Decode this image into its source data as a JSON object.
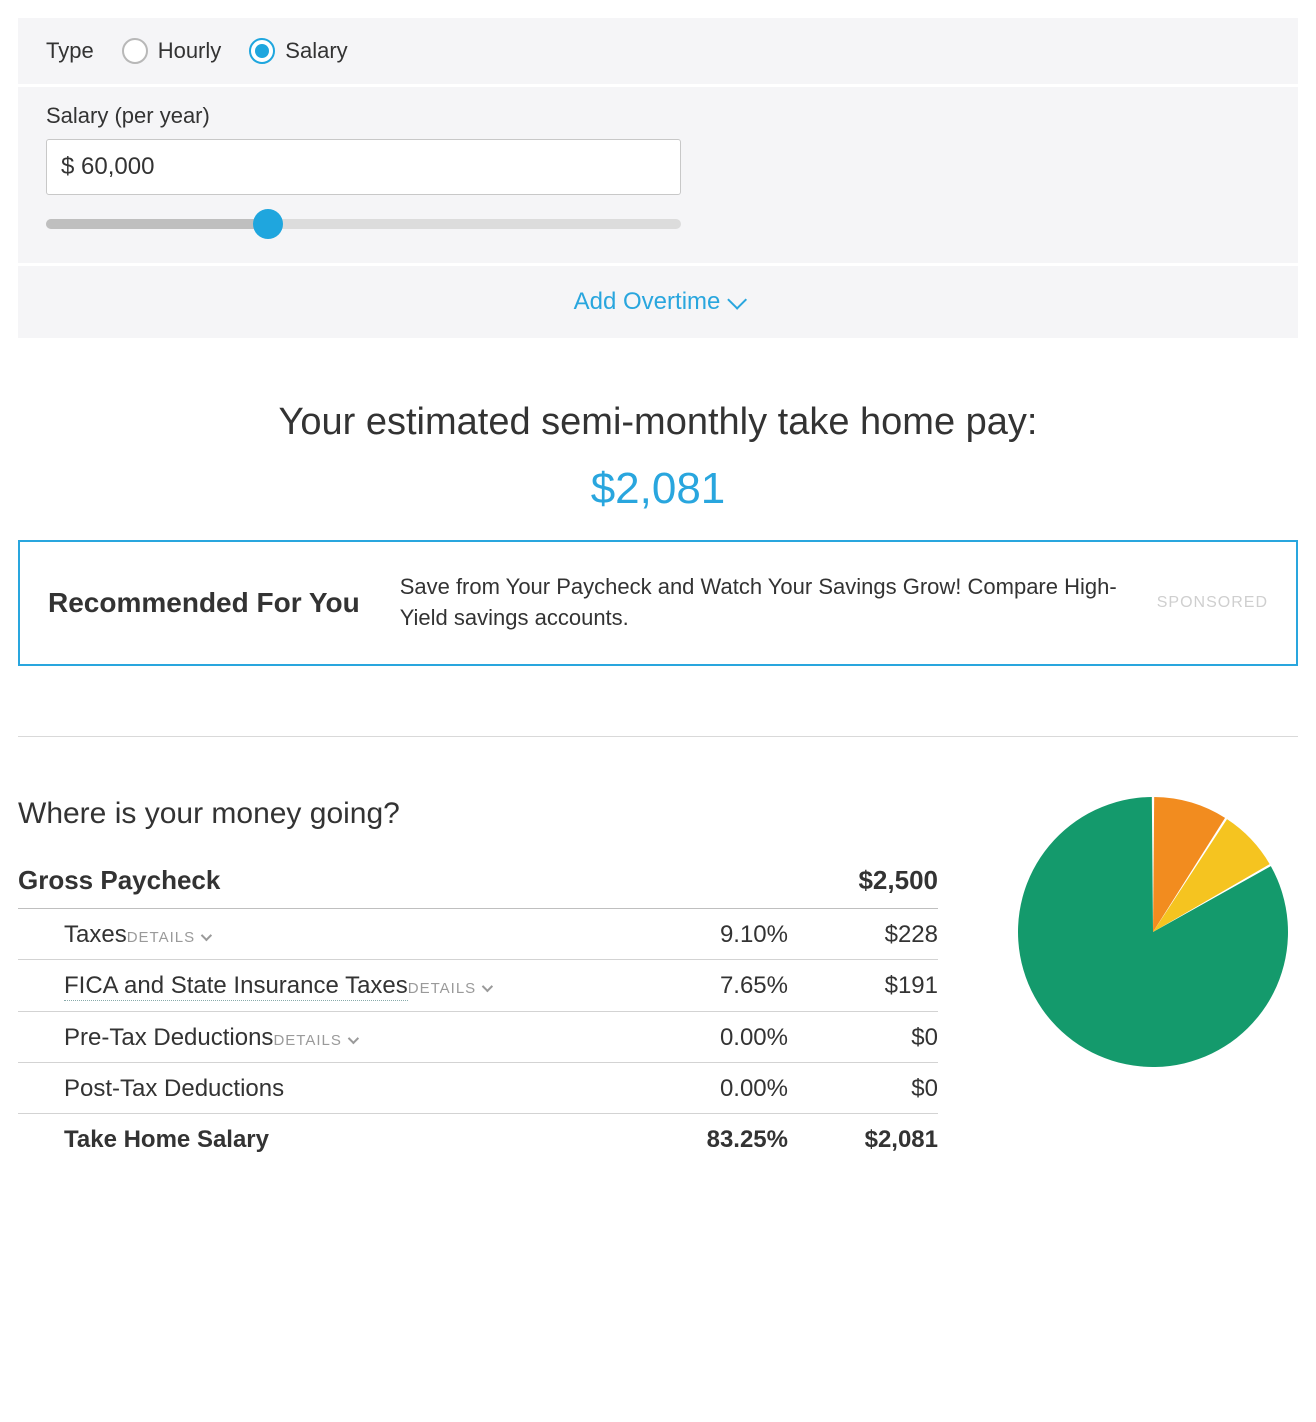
{
  "type": {
    "label": "Type",
    "options": {
      "hourly": "Hourly",
      "salary": "Salary"
    },
    "selected": "salary"
  },
  "salary": {
    "label": "Salary (per year)",
    "value": "$ 60,000",
    "slider_percent": 35
  },
  "overtime": {
    "label": "Add Overtime"
  },
  "estimate": {
    "title": "Your estimated semi-monthly take home pay:",
    "amount": "$2,081"
  },
  "promo": {
    "title": "Recommended For You",
    "text": "Save from Your Paycheck and Watch Your Savings Grow! Compare High-Yield savings accounts.",
    "sponsored": "SPONSORED"
  },
  "breakdown": {
    "title": "Where is your money going?",
    "gross": {
      "label": "Gross Paycheck",
      "amount": "$2,500"
    },
    "details_label": "DETAILS",
    "rows": [
      {
        "color": "#f28c1f",
        "name": "Taxes",
        "dotted": false,
        "pct": "9.10%",
        "amount": "$228",
        "details": true
      },
      {
        "color": "#f5c420",
        "name": "FICA and State Insurance Taxes",
        "dotted": true,
        "pct": "7.65%",
        "amount": "$191",
        "details": true
      },
      {
        "color": "#f5c420",
        "name": "Pre-Tax Deductions",
        "dotted": false,
        "pct": "0.00%",
        "amount": "$0",
        "details": true
      },
      {
        "color": "#7bcf5a",
        "name": "Post-Tax Deductions",
        "dotted": false,
        "pct": "0.00%",
        "amount": "$0",
        "details": false
      },
      {
        "color": "#149a6c",
        "name": "Take Home Salary",
        "dotted": false,
        "pct": "83.25%",
        "amount": "$2,081",
        "details": false,
        "bold": true
      }
    ]
  },
  "chart_data": {
    "type": "pie",
    "series": [
      {
        "name": "Taxes",
        "value": 9.1,
        "color": "#f28c1f"
      },
      {
        "name": "FICA and State Insurance Taxes",
        "value": 7.65,
        "color": "#f5c420"
      },
      {
        "name": "Pre-Tax Deductions",
        "value": 0.0,
        "color": "#f5c420"
      },
      {
        "name": "Post-Tax Deductions",
        "value": 0.0,
        "color": "#7bcf5a"
      },
      {
        "name": "Take Home Salary",
        "value": 83.25,
        "color": "#149a6c"
      }
    ]
  }
}
